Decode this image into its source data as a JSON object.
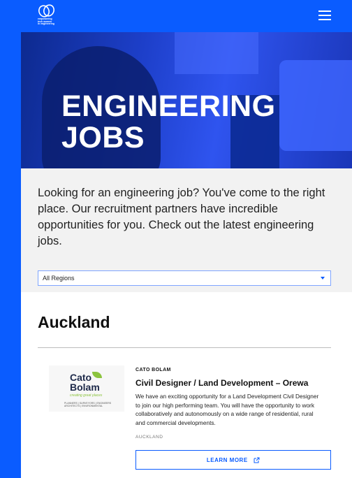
{
  "header": {
    "logo_text": "empowering\ntech women\nin engineering",
    "menu_icon": "hamburger-icon"
  },
  "hero": {
    "title": "ENGINEERING JOBS"
  },
  "intro": {
    "text": "Looking for an engineering job? You've come to the right place. Our recruitment partners have incredible opportunities for you. Check out the latest engineering jobs."
  },
  "filter": {
    "region_selected": "All Regions"
  },
  "section": {
    "heading": "Auckland"
  },
  "job": {
    "logo": {
      "name_line1": "Cato",
      "name_line2": "Bolam",
      "tagline": "creating great places",
      "small": "PLANNERS | SURVEYORS | ENGINEERS ARCHITECTS | ENVIRONMENTAL"
    },
    "company": "CATO BOLAM",
    "title": "Civil Designer / Land Development – Orewa",
    "description": "We have an exciting opportunity for a Land Development Civil Designer to join our high performing team. You will have the opportunity to work collaboratively and autonomously on a wide range of residential, rural and commercial developments.",
    "location": "AUCKLAND",
    "button_label": "LEARN MORE"
  },
  "colors": {
    "brand_blue": "#0a5cff",
    "intro_bg": "#f2f2f2",
    "leaf_green": "#8cc43f"
  }
}
